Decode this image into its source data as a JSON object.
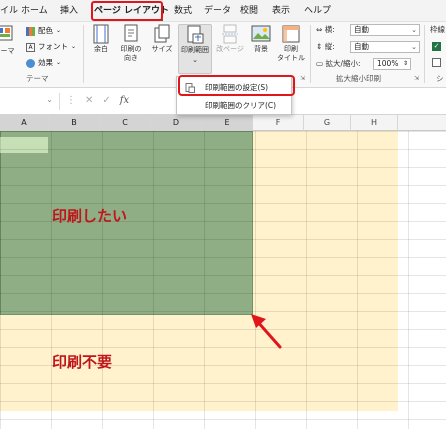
{
  "tabs": {
    "items": [
      "イル",
      "ホーム",
      "挿入",
      "ページ レイアウト",
      "数式",
      "データ",
      "校閲",
      "表示",
      "ヘルプ"
    ],
    "active": "ページ レイアウト"
  },
  "ribbon": {
    "theme_group": {
      "themes_label": "テーマ",
      "colors_label": "配色",
      "fonts_label": "フォント",
      "effects_label": "効果",
      "group_label": "テーマ"
    },
    "page_setup": {
      "margins_label": "余白",
      "orientation_label": "印刷の\n向き",
      "size_label": "サイズ",
      "print_area_label": "印刷範囲",
      "breaks_label": "改ページ",
      "background_label": "背景",
      "print_titles_label": "印刷\nタイトル"
    },
    "scale_group": {
      "width_label": "横:",
      "width_value": "自動",
      "height_label": "縦:",
      "height_value": "自動",
      "scale_label": "拡大/縮小:",
      "scale_value": "100%",
      "group_label": "拡大縮小印刷"
    },
    "sheet_options": {
      "gridlines_label": "枠線",
      "check": "✓"
    }
  },
  "menu": {
    "set_print_area": "印刷範囲の設定(S)",
    "clear_print_area": "印刷範囲のクリア(C)"
  },
  "formula_bar": {
    "fx": "fx"
  },
  "columns": [
    "A",
    "B",
    "C",
    "D",
    "E",
    "F",
    "G",
    "H"
  ],
  "sheet": {
    "print_text": "印刷したい",
    "no_print_text": "印刷不要"
  },
  "colors": {
    "highlight_red": "#e0161b",
    "print_area_green": "#8fae85",
    "outside_cream": "#fff2cc",
    "annotation_text": "#c0161b"
  }
}
